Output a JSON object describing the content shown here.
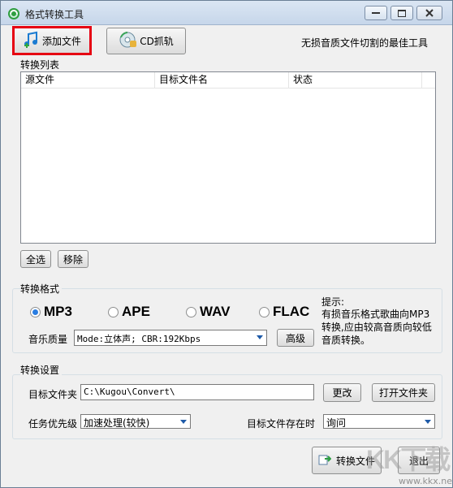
{
  "window": {
    "title": "格式转换工具"
  },
  "toolbar": {
    "add_file": "添加文件",
    "cd_rip": "CD抓轨",
    "slogan": "无损音质文件切割的最佳工具"
  },
  "list": {
    "label": "转换列表",
    "columns": [
      "源文件",
      "目标文件名",
      "状态"
    ],
    "select_all": "全选",
    "remove": "移除"
  },
  "format": {
    "label": "转换格式",
    "options": [
      "MP3",
      "APE",
      "WAV",
      "FLAC"
    ],
    "selected": "MP3",
    "quality_label": "音乐质量",
    "quality_value": "Mode:立体声; CBR:192Kbps",
    "advanced": "高级",
    "tip_title": "提示:",
    "tip_body": "  有损音乐格式歌曲向MP3转换,应由较高音质向较低音质转换。"
  },
  "settings": {
    "label": "转换设置",
    "target_folder_label": "目标文件夹",
    "target_folder_value": "C:\\Kugou\\Convert\\",
    "change": "更改",
    "open_folder": "打开文件夹",
    "priority_label": "任务优先级",
    "priority_value": "加速处理(较快)",
    "exists_label": "目标文件存在时",
    "exists_value": "询问"
  },
  "actions": {
    "convert": "转换文件",
    "exit": "退出"
  },
  "watermark": {
    "text": "KK下载",
    "url": "www.kkx.net"
  },
  "colors": {
    "highlight": "#e60012",
    "radio_on": "#2a7de1",
    "title_bg": "#dbe6f3"
  }
}
